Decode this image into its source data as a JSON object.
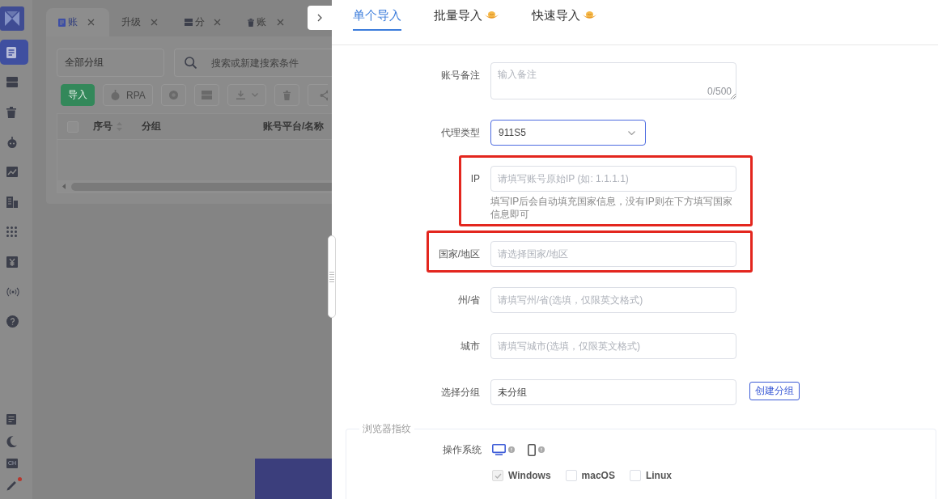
{
  "sidebar": {
    "items": [
      {
        "selected": true
      },
      {
        "selected": false
      },
      {
        "selected": false
      },
      {
        "selected": false
      },
      {
        "selected": false
      },
      {
        "selected": false
      },
      {
        "selected": false
      },
      {
        "selected": false
      },
      {
        "selected": false
      },
      {
        "selected": false
      }
    ],
    "footer": {
      "language": "CH",
      "notify_dot": true
    }
  },
  "workspace": {
    "tabs": [
      {
        "label": "账",
        "selected": true
      },
      {
        "label": "升级",
        "selected": false
      },
      {
        "label": "分",
        "selected": false
      },
      {
        "label": "账",
        "selected": false
      }
    ],
    "group_filter": {
      "value": "全部分组"
    },
    "search": {
      "placeholder": "搜索或新建搜索条件"
    },
    "toolbar": [
      {
        "kind": "primary",
        "label": "导入"
      },
      {
        "kind": "icon_text",
        "label": "RPA"
      }
    ],
    "table": {
      "select_all": {
        "checked": false
      },
      "columns": [
        {
          "label": "序号",
          "sortable": true
        },
        {
          "label": "分组",
          "sortable": false
        },
        {
          "label": "账号平台/名称",
          "sortable": false
        }
      ]
    }
  },
  "drawer": {
    "tabs": [
      {
        "label": "单个导入",
        "selected": true,
        "icon": false
      },
      {
        "label": "批量导入",
        "selected": false,
        "icon": true
      },
      {
        "label": "快速导入",
        "selected": false,
        "icon": true
      }
    ],
    "form": {
      "fields": [
        {
          "kind": "textarea",
          "label": "账号备注",
          "placeholder": "输入备注",
          "counter": "0/500",
          "highlighted": false
        },
        {
          "kind": "select",
          "label": "代理类型",
          "value": "911S5",
          "focused": true,
          "highlighted": false
        },
        {
          "kind": "input",
          "label": "IP",
          "placeholder": "请填写账号原始IP (如: 1.1.1.1)",
          "help": "填写IP后会自动填充国家信息，没有IP则在下方填写国家信息即可",
          "highlighted": true
        },
        {
          "kind": "input",
          "label": "国家/地区",
          "placeholder": "请选择国家/地区",
          "highlighted": true
        },
        {
          "kind": "input",
          "label": "州/省",
          "placeholder": "请填写州/省(选填，仅限英文格式)",
          "highlighted": false
        },
        {
          "kind": "input",
          "label": "城市",
          "placeholder": "请填写城市(选填，仅限英文格式)",
          "highlighted": false
        },
        {
          "kind": "input",
          "label": "选择分组",
          "value": "未分组",
          "action": "创建分组",
          "highlighted": false
        }
      ]
    },
    "fingerprint": {
      "legend": "浏览器指纹",
      "os_label": "操作系统",
      "devices": [
        {
          "kind": "desktop",
          "selected": true
        },
        {
          "kind": "mobile",
          "selected": false
        }
      ],
      "os_options": [
        {
          "label": "Windows",
          "checked": true,
          "disabled": true
        },
        {
          "label": "macOS",
          "checked": false,
          "disabled": false
        },
        {
          "label": "Linux",
          "checked": false,
          "disabled": false
        }
      ]
    }
  }
}
